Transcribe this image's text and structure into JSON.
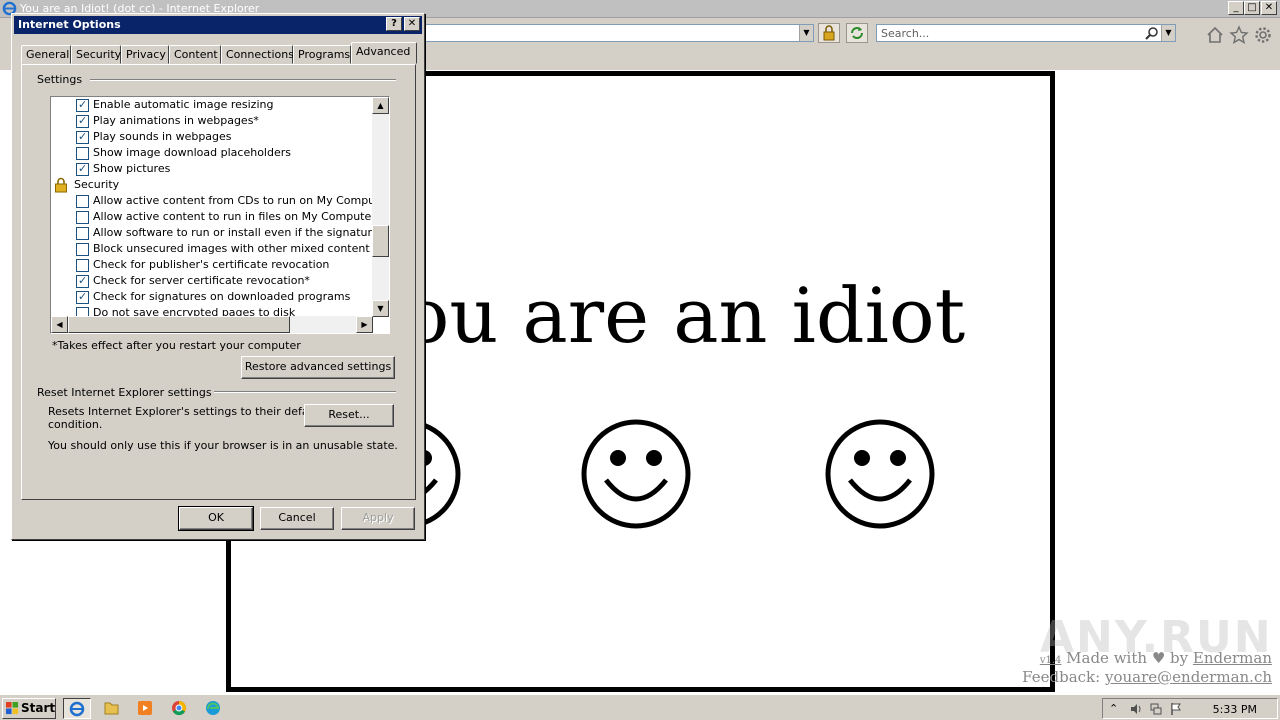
{
  "browser": {
    "window_title": "You are an Idiot! (dot cc) - Internet Explorer",
    "search_placeholder": "Search...",
    "window_buttons": {
      "minimize": "_",
      "maximize": "□",
      "close": "✕"
    }
  },
  "page": {
    "headline": "You are an idiot",
    "footer": {
      "version": "v1.4",
      "made_with": "Made with",
      "by": "by",
      "author": "Enderman",
      "feedback_label": "Feedback:",
      "feedback_email": "youare@enderman.ch"
    },
    "watermark": "ANY.RUN"
  },
  "dialog": {
    "title": "Internet Options",
    "help_button": "?",
    "close_button": "✕",
    "tabs": [
      {
        "label": "General",
        "active": false
      },
      {
        "label": "Security",
        "active": false
      },
      {
        "label": "Privacy",
        "active": false
      },
      {
        "label": "Content",
        "active": false
      },
      {
        "label": "Connections",
        "active": false
      },
      {
        "label": "Programs",
        "active": false
      },
      {
        "label": "Advanced",
        "active": true
      }
    ],
    "settings_group": "Settings",
    "settings_items": [
      {
        "type": "checkbox",
        "checked": true,
        "label": "Enable automatic image resizing"
      },
      {
        "type": "checkbox",
        "checked": true,
        "label": "Play animations in webpages*"
      },
      {
        "type": "checkbox",
        "checked": true,
        "label": "Play sounds in webpages"
      },
      {
        "type": "checkbox",
        "checked": false,
        "label": "Show image download placeholders"
      },
      {
        "type": "checkbox",
        "checked": true,
        "label": "Show pictures"
      },
      {
        "type": "category",
        "icon": "lock-icon",
        "label": "Security"
      },
      {
        "type": "checkbox",
        "checked": false,
        "label": "Allow active content from CDs to run on My Computer*"
      },
      {
        "type": "checkbox",
        "checked": false,
        "label": "Allow active content to run in files on My Computer*"
      },
      {
        "type": "checkbox",
        "checked": false,
        "label": "Allow software to run or install even if the signature is inva"
      },
      {
        "type": "checkbox",
        "checked": false,
        "label": "Block unsecured images with other mixed content"
      },
      {
        "type": "checkbox",
        "checked": false,
        "label": "Check for publisher's certificate revocation"
      },
      {
        "type": "checkbox",
        "checked": true,
        "label": "Check for server certificate revocation*"
      },
      {
        "type": "checkbox",
        "checked": true,
        "label": "Check for signatures on downloaded programs"
      },
      {
        "type": "checkbox",
        "checked": false,
        "label": "Do not save encrypted pages to disk"
      }
    ],
    "restart_note": "*Takes effect after you restart your computer",
    "restore_button": "Restore advanced settings",
    "reset_group": "Reset Internet Explorer settings",
    "reset_description_line1": "Resets Internet Explorer's settings to their default",
    "reset_description_line2": "condition.",
    "reset_button": "Reset...",
    "reset_warning": "You should only use this if your browser is in an unusable state.",
    "ok_button": "OK",
    "cancel_button": "Cancel",
    "apply_button": "Apply"
  },
  "taskbar": {
    "start_label": "Start",
    "time": "5:33 PM",
    "pinned": [
      "internet-explorer-icon",
      "folder-icon",
      "media-player-icon",
      "chrome-icon",
      "edge-icon"
    ]
  },
  "colors": {
    "dialog_title_bg": "#0a246a",
    "check_color": "#1c5180",
    "page_border": "#000000"
  }
}
